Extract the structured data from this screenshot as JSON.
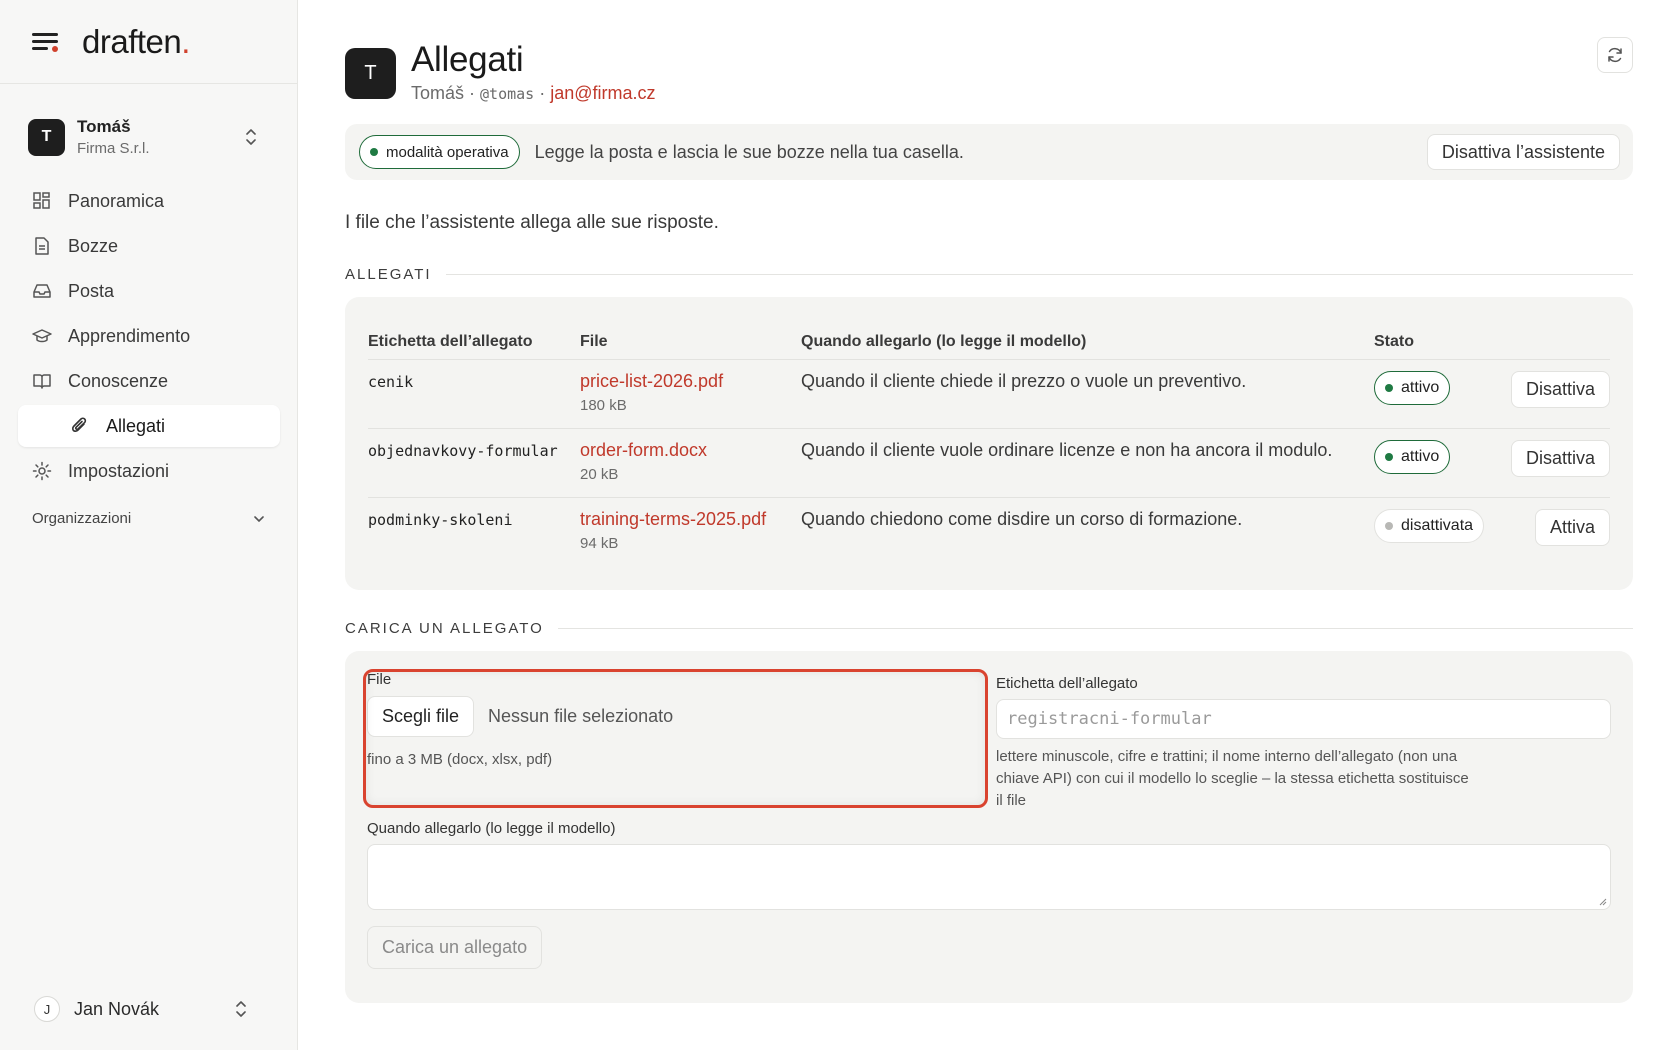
{
  "brand": {
    "name": "draften",
    "dot": "."
  },
  "account": {
    "name": "Tomáš",
    "company": "Firma S.r.l.",
    "initial": "T"
  },
  "nav": {
    "overview": "Panoramica",
    "drafts": "Bozze",
    "mail": "Posta",
    "learning": "Apprendimento",
    "knowledge": "Conoscenze",
    "attachments": "Allegati",
    "settings": "Impostazioni"
  },
  "organizations_label": "Organizzazioni",
  "user": {
    "name": "Jan Novák",
    "initial": "J"
  },
  "header": {
    "initial": "T",
    "title": "Allegati",
    "name": "Tomáš",
    "separator": " · ",
    "handle": "@tomas",
    "email": "jan@firma.cz"
  },
  "banner": {
    "mode": "modalità operativa",
    "text": "Legge la posta e lascia le sue bozze nella tua casella.",
    "button": "Disattiva l’assistente"
  },
  "intro": "I file che l’assistente allega alle sue risposte.",
  "attachments_section": {
    "title": "ALLEGATI",
    "columns": [
      "Etichetta dell’allegato",
      "File",
      "Quando allegarlo (lo legge il modello)",
      "Stato"
    ],
    "rows": [
      {
        "label": "cenik",
        "file": "price-list-2026.pdf",
        "size": "180 kB",
        "when": "Quando il cliente chiede il prezzo o vuole un preventivo.",
        "status": "attivo",
        "action": "Disattiva"
      },
      {
        "label": "objednavkovy-formular",
        "file": "order-form.docx",
        "size": "20 kB",
        "when": "Quando il cliente vuole ordinare licenze e non ha ancora il modulo.",
        "status": "attivo",
        "action": "Disattiva"
      },
      {
        "label": "podminky-skoleni",
        "file": "training-terms-2025.pdf",
        "size": "94 kB",
        "when": "Quando chiedono come disdire un corso di formazione.",
        "status": "disattivata",
        "action": "Attiva"
      }
    ]
  },
  "upload_section": {
    "title": "CARICA UN ALLEGATO",
    "file_label": "File",
    "choose_button": "Scegli file",
    "no_file": "Nessun file selezionato",
    "file_hint": "fino a 3 MB (docx, xlsx, pdf)",
    "tag_label": "Etichetta dell’allegato",
    "tag_placeholder": "registracni-formular",
    "tag_hint_1": "lettere minuscole, cifre e trattini; il nome interno dell’allegato (non una",
    "tag_hint_2": "chiave API) con cui il modello lo sceglie – la stessa etichetta sostituisce",
    "tag_hint_3": "il file",
    "when_label": "Quando allegarlo (lo legge il modello)",
    "submit": "Carica un allegato"
  },
  "colors": {
    "accent": "#c0392b",
    "active": "#1f7a43",
    "highlight": "#d9432f"
  }
}
